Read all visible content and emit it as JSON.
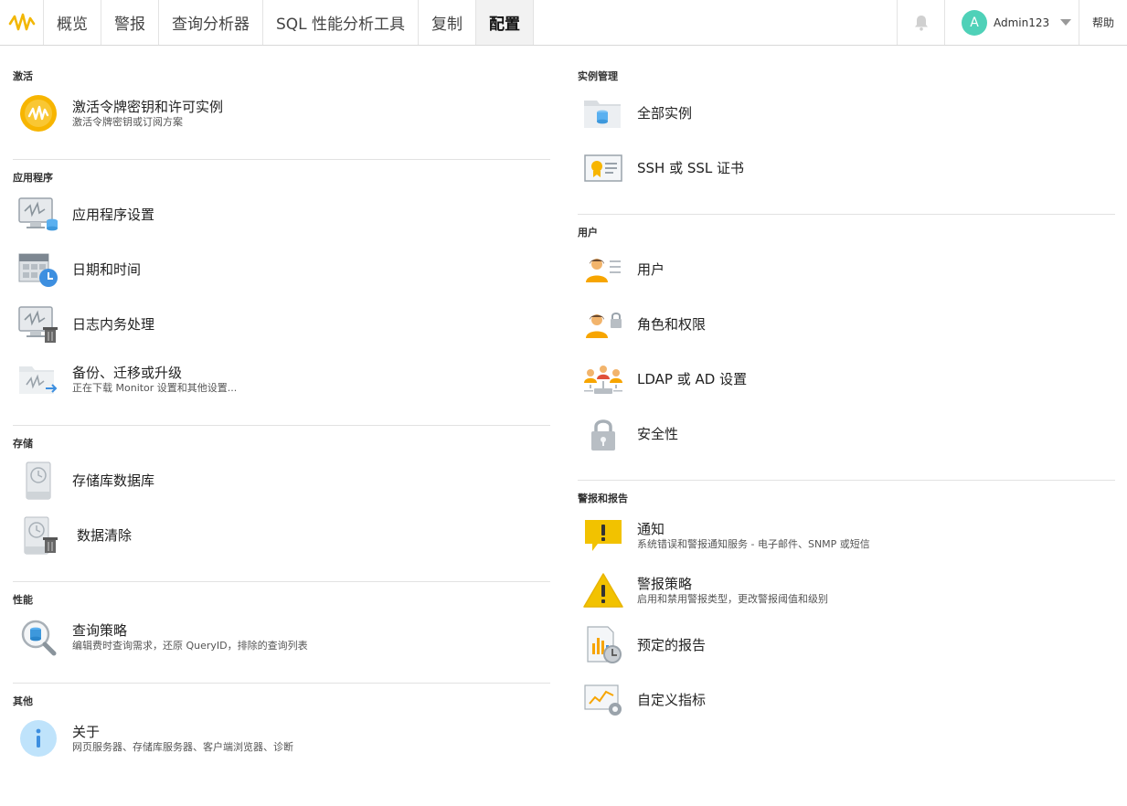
{
  "nav": {
    "tabs": [
      {
        "label": "概览"
      },
      {
        "label": "警报"
      },
      {
        "label": "查询分析器"
      },
      {
        "label": "SQL 性能分析工具"
      },
      {
        "label": "复制"
      },
      {
        "label": "配置"
      }
    ],
    "active_tab": "配置",
    "user": {
      "avatar_letter": "A",
      "name": "Admin123"
    },
    "help_label": "帮助"
  },
  "left": {
    "sections": [
      {
        "title": "激活",
        "items": [
          {
            "label": "激活令牌密钥和许可实例",
            "desc": "激活令牌密钥或订阅方案",
            "icon": "license-coin-icon"
          }
        ]
      },
      {
        "title": "应用程序",
        "items": [
          {
            "label": "应用程序设置",
            "desc": "",
            "icon": "monitor-database-icon"
          },
          {
            "label": "日期和时间",
            "desc": "",
            "icon": "calendar-clock-icon"
          },
          {
            "label": "日志内务处理",
            "desc": "",
            "icon": "monitor-trash-icon"
          },
          {
            "label": "备份、迁移或升级",
            "desc": "正在下载 Monitor 设置和其他设置...",
            "icon": "folder-arrow-icon"
          }
        ]
      },
      {
        "title": "存储",
        "items": [
          {
            "label": "存储库数据库",
            "desc": "",
            "icon": "history-disk-icon"
          },
          {
            "label": "数据清除",
            "desc": "",
            "icon": "history-disk-trash-icon"
          }
        ]
      },
      {
        "title": "性能",
        "items": [
          {
            "label": "查询策略",
            "desc": "编辑费时查询需求，还原 QueryID，排除的查询列表",
            "icon": "magnifier-database-icon"
          }
        ]
      },
      {
        "title": "其他",
        "items": [
          {
            "label": "关于",
            "desc": "网页服务器、存储库服务器、客户端浏览器、诊断",
            "icon": "info-icon"
          }
        ]
      }
    ]
  },
  "right": {
    "sections": [
      {
        "title": "实例管理",
        "items": [
          {
            "label": "全部实例",
            "desc": "",
            "icon": "folder-database-icon"
          },
          {
            "label": "SSH 或 SSL 证书",
            "desc": "",
            "icon": "certificate-icon"
          }
        ]
      },
      {
        "title": "用户",
        "items": [
          {
            "label": "用户",
            "desc": "",
            "icon": "user-list-icon"
          },
          {
            "label": "角色和权限",
            "desc": "",
            "icon": "user-lock-icon"
          },
          {
            "label": "LDAP 或 AD 设置",
            "desc": "",
            "icon": "user-group-network-icon"
          },
          {
            "label": "安全性",
            "desc": "",
            "icon": "padlock-icon"
          }
        ]
      },
      {
        "title": "警报和报告",
        "items": [
          {
            "label": "通知",
            "desc": "系统错误和警报通知服务 - 电子邮件、SNMP 或短信",
            "icon": "notification-bubble-icon"
          },
          {
            "label": "警报策略",
            "desc": "启用和禁用警报类型，更改警报阈值和级别",
            "icon": "warning-triangle-icon"
          },
          {
            "label": "预定的报告",
            "desc": "",
            "icon": "report-clock-icon"
          },
          {
            "label": "自定义指标",
            "desc": "",
            "icon": "chart-gear-icon"
          }
        ]
      }
    ]
  }
}
